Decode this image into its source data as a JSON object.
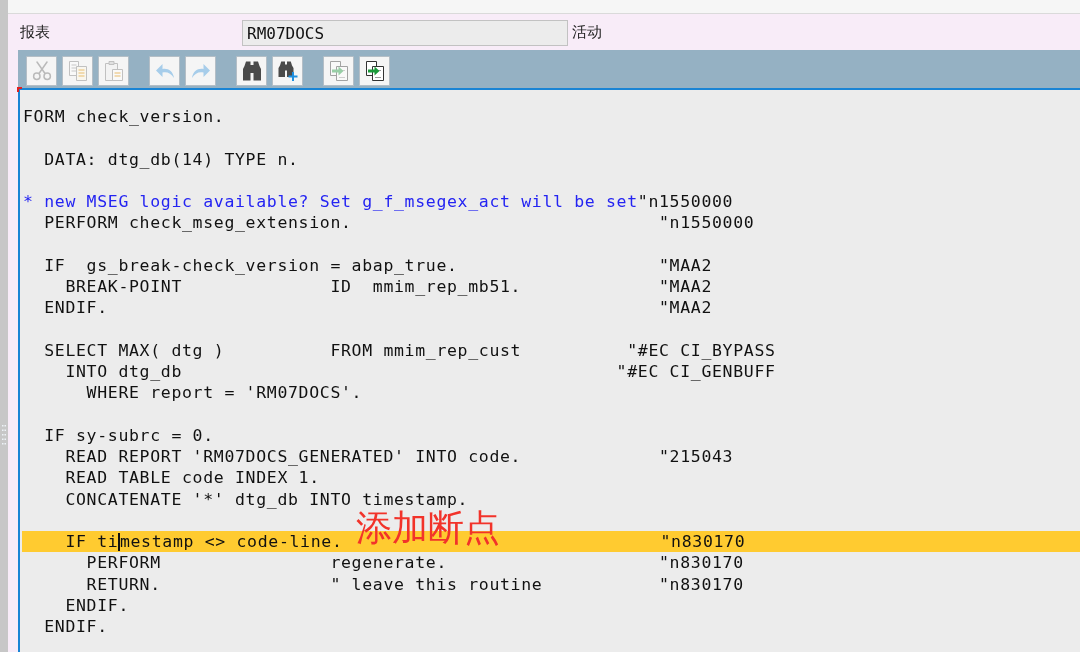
{
  "report_field": {
    "label": "报表",
    "value": "RM07DOCS",
    "status": "活动"
  },
  "toolbar": [
    {
      "buttons": [
        {
          "kind": "cut",
          "disabled": true
        },
        {
          "kind": "copy",
          "disabled": true
        },
        {
          "kind": "paste",
          "disabled": true
        }
      ]
    },
    {
      "buttons": [
        {
          "kind": "undo",
          "disabled": true
        },
        {
          "kind": "redo",
          "disabled": true
        }
      ]
    },
    {
      "buttons": [
        {
          "kind": "find",
          "disabled": false
        },
        {
          "kind": "find_next",
          "disabled": false
        }
      ]
    },
    {
      "buttons": [
        {
          "kind": "doc_arrow",
          "disabled": true
        },
        {
          "kind": "doc_arrow",
          "disabled": false
        }
      ]
    }
  ],
  "editor": {
    "annotation": "添加断点",
    "lines": [
      {
        "text": "FORM check_version.",
        "highlighted": false
      },
      {
        "highlighted": false
      },
      {
        "text": "  DATA: dtg_db(14) TYPE n.",
        "highlighted": false
      },
      {
        "highlighted": false
      },
      {
        "comment": "* new MSEG logic available? Set g_f_msegex_act will be set",
        "text": "\"n1550000",
        "highlighted": false
      },
      {
        "text": "  PERFORM check_mseg_extension.                             \"n1550000",
        "highlighted": false
      },
      {
        "highlighted": false
      },
      {
        "text": "  IF  gs_break-check_version = abap_true.                   \"MAA2",
        "highlighted": false
      },
      {
        "text": "    BREAK-POINT              ID  mmim_rep_mb51.             \"MAA2",
        "highlighted": false
      },
      {
        "text": "  ENDIF.                                                    \"MAA2",
        "highlighted": false
      },
      {
        "highlighted": false
      },
      {
        "text": "  SELECT MAX( dtg )          FROM mmim_rep_cust          \"#EC CI_BYPASS",
        "highlighted": false
      },
      {
        "text": "    INTO dtg_db                                         \"#EC CI_GENBUFF",
        "highlighted": false
      },
      {
        "text": "      WHERE report = 'RM07DOCS'.",
        "highlighted": false
      },
      {
        "highlighted": false
      },
      {
        "text": "  IF sy-subrc = 0.",
        "highlighted": false
      },
      {
        "text": "    READ REPORT 'RM07DOCS_GENERATED' INTO code.             \"215043",
        "highlighted": false
      },
      {
        "text": "    READ TABLE code INDEX 1.",
        "highlighted": false
      },
      {
        "text": "    CONCATENATE '*' dtg_db INTO timestamp.",
        "highlighted": false
      },
      {
        "highlighted": false
      },
      {
        "text": "    IF ti",
        "text_after_cursor": "mestamp <> code-line.                              \"n830170",
        "highlighted": true
      },
      {
        "text": "      PERFORM                regenerate.                    \"n830170",
        "highlighted": false
      },
      {
        "text": "      RETURN.                \" leave this routine           \"n830170",
        "highlighted": false
      },
      {
        "text": "    ENDIF.",
        "highlighted": false
      },
      {
        "text": "  ENDIF.",
        "highlighted": false
      }
    ]
  }
}
